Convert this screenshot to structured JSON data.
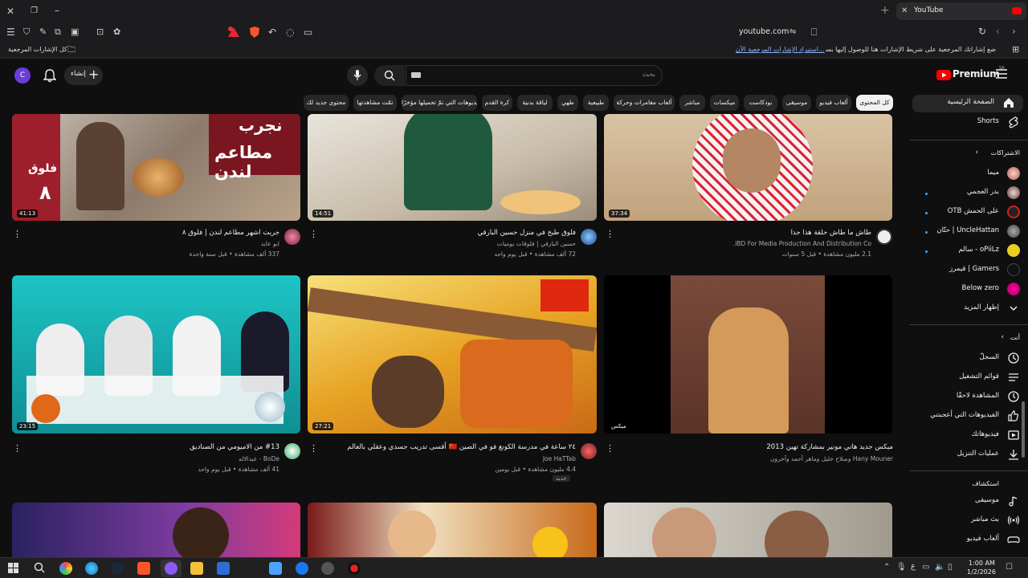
{
  "browser": {
    "tab_title": "YouTube",
    "address": "youtube.com",
    "bookmarks_hint": "ضع إشاراتك المرجعية على شريط الإشارات هنا للوصول إليها بسرعة.",
    "bookmarks_import": "استيراد الإشارات المرجعية الآن...",
    "all_bookmarks": "كل الإشارات المرجعية"
  },
  "header": {
    "logo": "Premium",
    "logo_sup": "SA",
    "search_placeholder": "بحث",
    "create_label": "إنشاء",
    "avatar_letter": "C"
  },
  "chips": [
    "كل المحتوى",
    "ألعاب فيديو",
    "موسيقى",
    "بودكاست",
    "ميكسات",
    "مباشر",
    "ألعاب مغامرات وحركة",
    "طبيعية",
    "طهي",
    "لياقة بدنية",
    "كرة القدم",
    "الفيديوهات التي تمّ تحميلها مؤخرًا",
    "تمّت مشاهدتها",
    "محتوى جديد لك"
  ],
  "sidebar": {
    "home": "الصفحة الرئيسية",
    "shorts": "Shorts",
    "subs_header": "الاشتراكات",
    "subs": [
      "ميما",
      "بدر العجمي",
      "على الحمش OTB",
      "UncleHattan | حتّان",
      "oPiiLz - سالم",
      "Gamers | قيمرز",
      "Below zero"
    ],
    "show_more": "إظهار المزيد",
    "you_header": "أنت",
    "you_items": [
      "السجلّ",
      "قوائم التشغيل",
      "المشاهدة لاحقًا",
      "الفيديوهات التي أعجبتني",
      "فيديوهاتك",
      "عمليات التنزيل"
    ],
    "explore_header": "استكشاف",
    "explore_items": [
      "موسيقى",
      "بث مباشر",
      "ألعاب فيديو"
    ]
  },
  "videos": [
    {
      "title": "جربت اشهر مطاعم لندن | فلوق ٨",
      "channel": "ابو عابد",
      "meta": "337 ألف مشاهدة • قبل سنة واحدة",
      "duration": "41:13",
      "thumb_text1": "نجرب",
      "thumb_text2": "مطاعم لندن",
      "thumb_text3": "فلوق",
      "thumb_text4": "٨"
    },
    {
      "title": "فلوق طبخ في منزل حسين البارقي",
      "channel": "حسين البارقي | فلوقات يوميات",
      "meta": "72 ألف مشاهدة • قبل يوم واحد",
      "duration": "14:51"
    },
    {
      "title": "طاش ما طاش حلقة هذا جدا",
      "channel": "IBD For Media Production And Distribution Co.",
      "meta": "2.1 مليون مشاهدة • قبل 5 سنوات",
      "duration": "37:34"
    },
    {
      "title": "#13 من الاميومي من الصناديق",
      "channel": "BoDe - عبدالاله",
      "meta": "41 ألف مشاهدة • قبل يوم واحد",
      "duration": "23:15"
    },
    {
      "title": "٢٤ ساعة في مدرسة الكونغ فو في الصين 🇨🇳 أقسى تدريب جسدي وعقلي بالعالم",
      "channel": "Joe HaTTab",
      "meta": "4.4 مليون مشاهدة • قبل يومين",
      "duration": "27:21",
      "badge": "جديد"
    },
    {
      "title": "ميكس جديد هاني مونير بمشاركة تهين 2013",
      "channel": "Hany Mouner وصلاح خليل وماهر أحمد وآخرون",
      "meta": "",
      "duration": "ميكس"
    }
  ],
  "taskbar": {
    "time": "1:00 AM",
    "date": "1/2/2026",
    "lang": "ع"
  },
  "colors": {
    "bg": "#0f0f0f",
    "red": "#ff0000",
    "chip": "#272727"
  }
}
